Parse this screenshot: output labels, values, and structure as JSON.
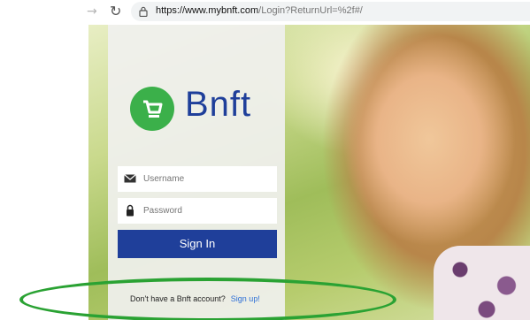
{
  "browser": {
    "url_host": "https://www.mybnft.com",
    "url_path": "/Login?ReturnUrl=%2f#/"
  },
  "brand": {
    "name": "Bnft",
    "primary_color": "#1f3f9a",
    "accent_color": "#3bb04a",
    "logo_icon": "cart-icon"
  },
  "login": {
    "username_placeholder": "Username",
    "password_placeholder": "Password",
    "signin_label": "Sign In",
    "signup_prompt": "Don't have a Bnft account?",
    "signup_link": "Sign up!"
  },
  "annotation": {
    "highlight_color": "#2aa233"
  }
}
